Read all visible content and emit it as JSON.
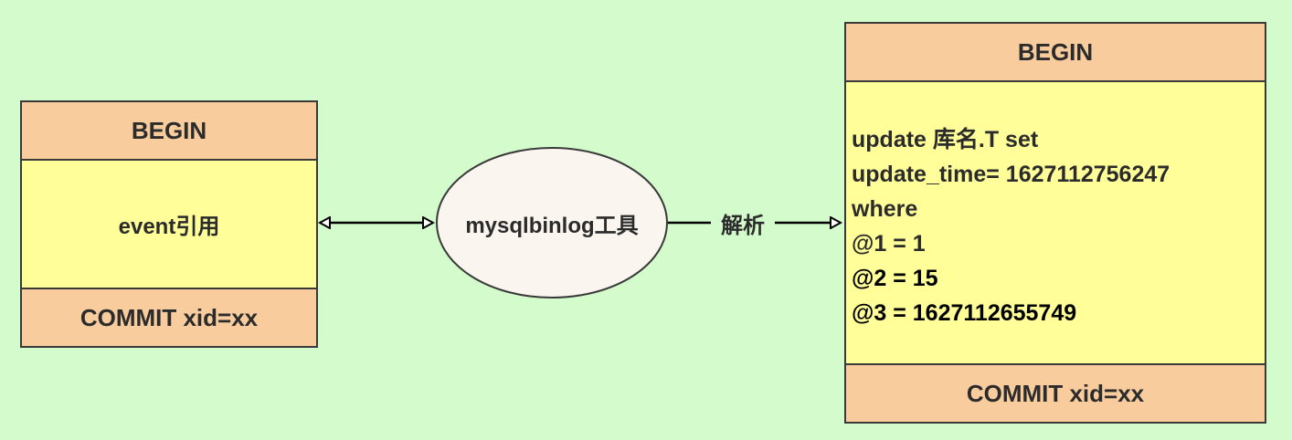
{
  "left_box": {
    "header": "BEGIN",
    "body": "event引用",
    "footer": "COMMIT xid=xx"
  },
  "tool": {
    "label": "mysqlbinlog工具"
  },
  "edge": {
    "label": "解析"
  },
  "right_box": {
    "header": "BEGIN",
    "lines": [
      "update 库名.T set",
      "update_time= 1627112756247",
      "where",
      "@1 = 1",
      "@2 = 15",
      "@3 = 1627112655749"
    ],
    "footer": "COMMIT xid=xx"
  },
  "colors": {
    "background": "#d4fbcb",
    "box_header": "#f8cc9d",
    "box_body": "#fffe98",
    "ellipse_fill": "#faf6ef",
    "stroke": "#3a3a3a"
  }
}
